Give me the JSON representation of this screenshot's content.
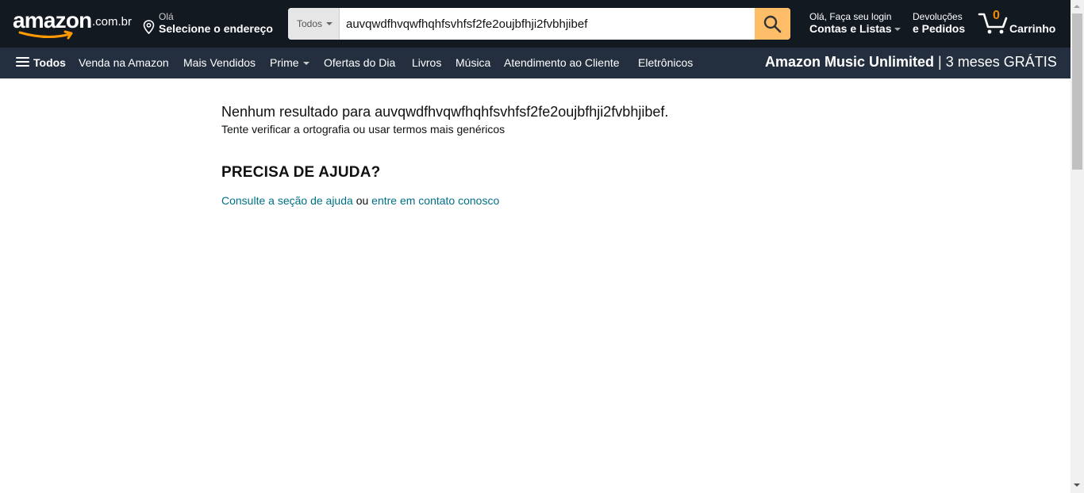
{
  "header": {
    "logo_text": "amazon",
    "logo_tld": ".com.br",
    "location": {
      "greeting": "Olá",
      "action": "Selecione o endereço",
      "icon": "location-pin-icon"
    },
    "search": {
      "category": "Todos",
      "query": "auvqwdfhvqwfhqhfsvhfsf2fe2oujbfhji2fvbhjibef",
      "icon": "search-icon"
    },
    "account": {
      "line1": "Olá, Faça seu login",
      "line2": "Contas e Listas"
    },
    "orders": {
      "line1": "Devoluções",
      "line2": "e Pedidos"
    },
    "cart": {
      "count": "0",
      "label": "Carrinho",
      "icon": "cart-icon"
    }
  },
  "subnav": {
    "all_label": "Todos",
    "links": [
      "Venda na Amazon",
      "Mais Vendidos",
      "Prime",
      "Ofertas do Dia",
      "Livros",
      "Música",
      "Atendimento ao Cliente",
      "Eletrônicos"
    ],
    "promo_bold": "Amazon Music Unlimited",
    "promo_rest": "| 3 meses GRÁTIS"
  },
  "results": {
    "no_result": "Nenhum resultado para auvqwdfhvqwfhqhfsvhfsf2fe2oujbfhji2fvbhjibef.",
    "hint": "Tente verificar a ortografia ou usar termos mais genéricos",
    "help_title": "PRECISA DE AJUDA?",
    "help_link1": "Consulte a seção de ajuda",
    "help_or": "ou",
    "help_link2": "entre em contato conosco"
  },
  "colors": {
    "header_bg": "#131921",
    "subnav_bg": "#232f3e",
    "search_button": "#febd69",
    "cart_count": "#f08804",
    "link": "#007185"
  }
}
